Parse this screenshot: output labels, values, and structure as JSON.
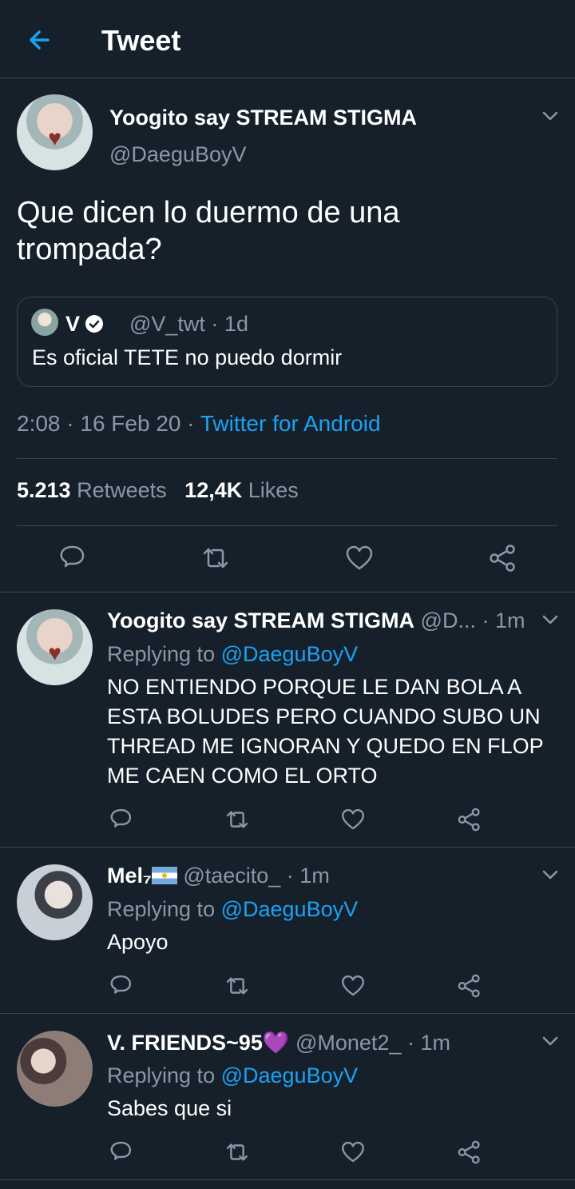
{
  "header": {
    "title": "Tweet"
  },
  "tweet": {
    "author_name": "Yoogito say STREAM STIGMA",
    "author_handle": "@DaeguBoyV",
    "text": "Que dicen lo duermo de una trompada?",
    "quote": {
      "name": "V",
      "handle_time": "@V_twt · 1d",
      "text": "Es oficial TETE no puedo dormir"
    },
    "meta_time": "2:08 · 16 Feb 20 · ",
    "meta_source": "Twitter for Android",
    "retweets_count": "5.213",
    "retweets_label": "Retweets",
    "likes_count": "12,4K",
    "likes_label": "Likes"
  },
  "replies": [
    {
      "name": "Yoogito say STREAM STIGMA",
      "handle_time": "@D... · 1m",
      "replying_label": "Replying to ",
      "replying_handle": "@DaeguBoyV",
      "text": "NO ENTIENDO PORQUE LE DAN BOLA A ESTA BOLUDES PERO CUANDO SUBO UN THREAD ME IGNORAN Y QUEDO EN FLOP ME CAEN COMO EL ORTO"
    },
    {
      "name": "Mel₇",
      "handle_time": "@taecito_ · 1m",
      "replying_label": "Replying to ",
      "replying_handle": "@DaeguBoyV",
      "text": "Apoyo"
    },
    {
      "name": "V. FRIENDS~95",
      "name_emoji": "💜",
      "handle_time": "@Monet2_ · 1m",
      "replying_label": "Replying to ",
      "replying_handle": "@DaeguBoyV",
      "text": "Sabes que si"
    }
  ],
  "colors": {
    "background": "#15202b",
    "accent": "#1da1f2",
    "secondary_text": "#8899a6",
    "divider": "#38444d"
  },
  "icons": [
    "back-arrow-icon",
    "chevron-down-icon",
    "reply-icon",
    "retweet-icon",
    "like-icon",
    "share-icon",
    "verified-badge-icon"
  ]
}
